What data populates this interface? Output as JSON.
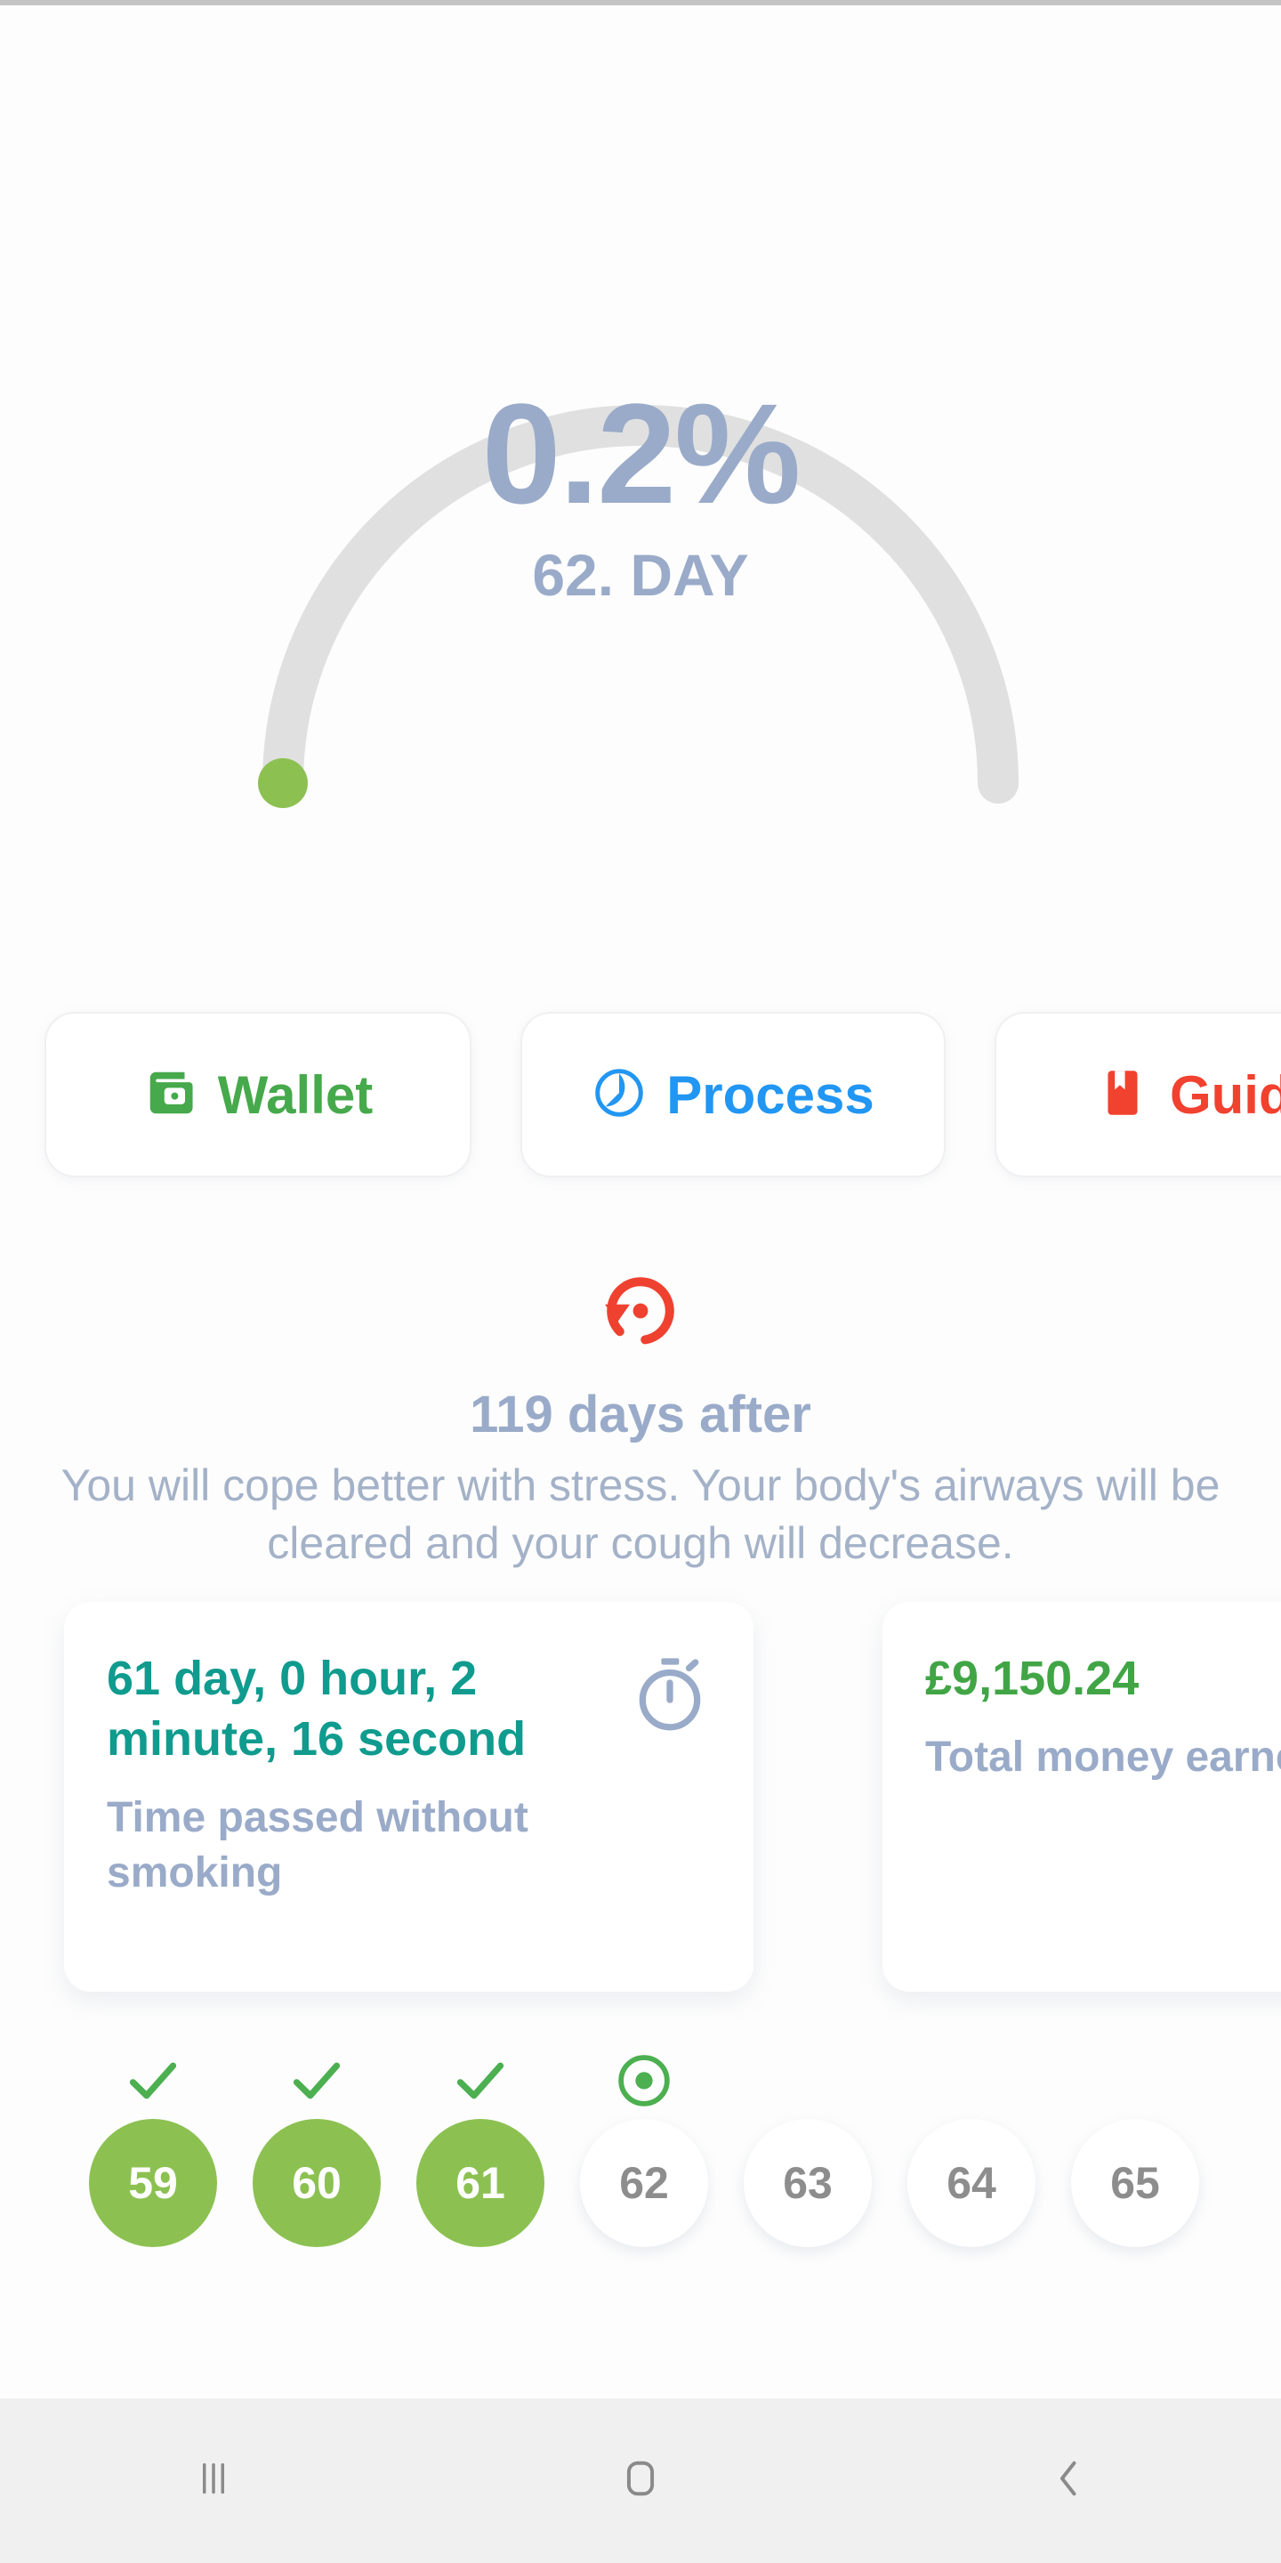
{
  "colors": {
    "track": "#e0e0e0",
    "progress_dot": "#8cc152",
    "muted_blue": "#9aabc9",
    "wallet_green": "#46a94b",
    "process_blue": "#2196f3",
    "guide_red": "#f1412f",
    "restore_red": "#ef4130",
    "teal": "#0f9b8e",
    "money_green": "#41a546",
    "day_done_green": "#8cc152",
    "day_todo_text": "#8d8d8d",
    "navbar_bg": "#f0f0f0"
  },
  "gauge": {
    "percent": "0.2%",
    "day_line": "62. DAY",
    "percent_value": 0.2,
    "current_day": 62
  },
  "actions": [
    {
      "label": "Wallet",
      "icon": "wallet-icon"
    },
    {
      "label": "Process",
      "icon": "pie-clock-icon"
    },
    {
      "label": "Guide",
      "icon": "bookmark-icon"
    }
  ],
  "milestone": {
    "icon": "restore-clockwise-icon",
    "title": "119 days after",
    "description": "You will cope better with stress. Your body's airways will be cleared and your cough will decrease."
  },
  "stats": [
    {
      "value": "61 day, 0 hour, 2 minute, 16 second",
      "label": "Time passed without smoking",
      "icon": "stopwatch-icon"
    },
    {
      "value": "£9,150.24",
      "label": "Total money earned",
      "icon": ""
    }
  ],
  "streak": [
    {
      "day": "59",
      "state": "done",
      "mark": "check-icon"
    },
    {
      "day": "60",
      "state": "done",
      "mark": "check-icon"
    },
    {
      "day": "61",
      "state": "done",
      "mark": "check-icon"
    },
    {
      "day": "62",
      "state": "current",
      "mark": "target-dot-icon"
    },
    {
      "day": "63",
      "state": "future",
      "mark": ""
    },
    {
      "day": "64",
      "state": "future",
      "mark": ""
    },
    {
      "day": "65",
      "state": "future",
      "mark": ""
    }
  ],
  "navbar": [
    {
      "name": "recents-button"
    },
    {
      "name": "home-button"
    },
    {
      "name": "back-button"
    }
  ]
}
